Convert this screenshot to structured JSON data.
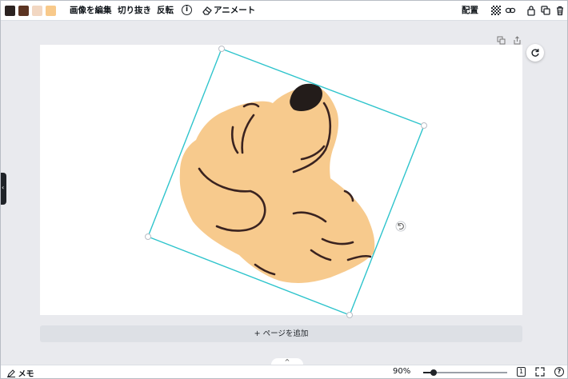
{
  "toolbar": {
    "swatches": [
      {
        "name": "color-swatch-dark",
        "color": "#2b2220"
      },
      {
        "name": "color-swatch-brown",
        "color": "#5c3422"
      },
      {
        "name": "color-swatch-cream",
        "color": "#f2d7c2"
      },
      {
        "name": "color-swatch-peach",
        "color": "#f8c98a"
      }
    ],
    "edit_image_label": "画像を編集",
    "crop_label": "切り抜き",
    "flip_label": "反転",
    "info_glyph": "i",
    "animate_label": "アニメート",
    "position_label": "配置"
  },
  "canvas": {
    "add_page_label": "+ ページを追加",
    "colors": {
      "selection": "#2ec4cc",
      "fur": "#f7ca8d",
      "lines": "#3a2320",
      "nose": "#231c1a"
    }
  },
  "bottom_bar": {
    "memo_label": "メモ",
    "zoom_label": "90%",
    "zoom_value": 0.12,
    "page_count": "1",
    "help_glyph": "?",
    "collapse_glyph": "^"
  }
}
